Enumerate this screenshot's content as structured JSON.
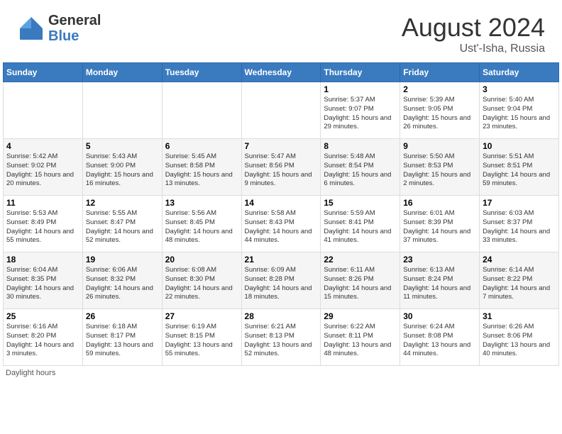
{
  "header": {
    "logo_general": "General",
    "logo_blue": "Blue",
    "month_title": "August 2024",
    "location": "Ust'-Isha, Russia"
  },
  "days_of_week": [
    "Sunday",
    "Monday",
    "Tuesday",
    "Wednesday",
    "Thursday",
    "Friday",
    "Saturday"
  ],
  "weeks": [
    [
      {
        "day": "",
        "info": ""
      },
      {
        "day": "",
        "info": ""
      },
      {
        "day": "",
        "info": ""
      },
      {
        "day": "",
        "info": ""
      },
      {
        "day": "1",
        "info": "Sunrise: 5:37 AM\nSunset: 9:07 PM\nDaylight: 15 hours\nand 29 minutes."
      },
      {
        "day": "2",
        "info": "Sunrise: 5:39 AM\nSunset: 9:05 PM\nDaylight: 15 hours\nand 26 minutes."
      },
      {
        "day": "3",
        "info": "Sunrise: 5:40 AM\nSunset: 9:04 PM\nDaylight: 15 hours\nand 23 minutes."
      }
    ],
    [
      {
        "day": "4",
        "info": "Sunrise: 5:42 AM\nSunset: 9:02 PM\nDaylight: 15 hours\nand 20 minutes."
      },
      {
        "day": "5",
        "info": "Sunrise: 5:43 AM\nSunset: 9:00 PM\nDaylight: 15 hours\nand 16 minutes."
      },
      {
        "day": "6",
        "info": "Sunrise: 5:45 AM\nSunset: 8:58 PM\nDaylight: 15 hours\nand 13 minutes."
      },
      {
        "day": "7",
        "info": "Sunrise: 5:47 AM\nSunset: 8:56 PM\nDaylight: 15 hours\nand 9 minutes."
      },
      {
        "day": "8",
        "info": "Sunrise: 5:48 AM\nSunset: 8:54 PM\nDaylight: 15 hours\nand 6 minutes."
      },
      {
        "day": "9",
        "info": "Sunrise: 5:50 AM\nSunset: 8:53 PM\nDaylight: 15 hours\nand 2 minutes."
      },
      {
        "day": "10",
        "info": "Sunrise: 5:51 AM\nSunset: 8:51 PM\nDaylight: 14 hours\nand 59 minutes."
      }
    ],
    [
      {
        "day": "11",
        "info": "Sunrise: 5:53 AM\nSunset: 8:49 PM\nDaylight: 14 hours\nand 55 minutes."
      },
      {
        "day": "12",
        "info": "Sunrise: 5:55 AM\nSunset: 8:47 PM\nDaylight: 14 hours\nand 52 minutes."
      },
      {
        "day": "13",
        "info": "Sunrise: 5:56 AM\nSunset: 8:45 PM\nDaylight: 14 hours\nand 48 minutes."
      },
      {
        "day": "14",
        "info": "Sunrise: 5:58 AM\nSunset: 8:43 PM\nDaylight: 14 hours\nand 44 minutes."
      },
      {
        "day": "15",
        "info": "Sunrise: 5:59 AM\nSunset: 8:41 PM\nDaylight: 14 hours\nand 41 minutes."
      },
      {
        "day": "16",
        "info": "Sunrise: 6:01 AM\nSunset: 8:39 PM\nDaylight: 14 hours\nand 37 minutes."
      },
      {
        "day": "17",
        "info": "Sunrise: 6:03 AM\nSunset: 8:37 PM\nDaylight: 14 hours\nand 33 minutes."
      }
    ],
    [
      {
        "day": "18",
        "info": "Sunrise: 6:04 AM\nSunset: 8:35 PM\nDaylight: 14 hours\nand 30 minutes."
      },
      {
        "day": "19",
        "info": "Sunrise: 6:06 AM\nSunset: 8:32 PM\nDaylight: 14 hours\nand 26 minutes."
      },
      {
        "day": "20",
        "info": "Sunrise: 6:08 AM\nSunset: 8:30 PM\nDaylight: 14 hours\nand 22 minutes."
      },
      {
        "day": "21",
        "info": "Sunrise: 6:09 AM\nSunset: 8:28 PM\nDaylight: 14 hours\nand 18 minutes."
      },
      {
        "day": "22",
        "info": "Sunrise: 6:11 AM\nSunset: 8:26 PM\nDaylight: 14 hours\nand 15 minutes."
      },
      {
        "day": "23",
        "info": "Sunrise: 6:13 AM\nSunset: 8:24 PM\nDaylight: 14 hours\nand 11 minutes."
      },
      {
        "day": "24",
        "info": "Sunrise: 6:14 AM\nSunset: 8:22 PM\nDaylight: 14 hours\nand 7 minutes."
      }
    ],
    [
      {
        "day": "25",
        "info": "Sunrise: 6:16 AM\nSunset: 8:20 PM\nDaylight: 14 hours\nand 3 minutes."
      },
      {
        "day": "26",
        "info": "Sunrise: 6:18 AM\nSunset: 8:17 PM\nDaylight: 13 hours\nand 59 minutes."
      },
      {
        "day": "27",
        "info": "Sunrise: 6:19 AM\nSunset: 8:15 PM\nDaylight: 13 hours\nand 55 minutes."
      },
      {
        "day": "28",
        "info": "Sunrise: 6:21 AM\nSunset: 8:13 PM\nDaylight: 13 hours\nand 52 minutes."
      },
      {
        "day": "29",
        "info": "Sunrise: 6:22 AM\nSunset: 8:11 PM\nDaylight: 13 hours\nand 48 minutes."
      },
      {
        "day": "30",
        "info": "Sunrise: 6:24 AM\nSunset: 8:08 PM\nDaylight: 13 hours\nand 44 minutes."
      },
      {
        "day": "31",
        "info": "Sunrise: 6:26 AM\nSunset: 8:06 PM\nDaylight: 13 hours\nand 40 minutes."
      }
    ]
  ],
  "footer": {
    "note": "Daylight hours"
  }
}
